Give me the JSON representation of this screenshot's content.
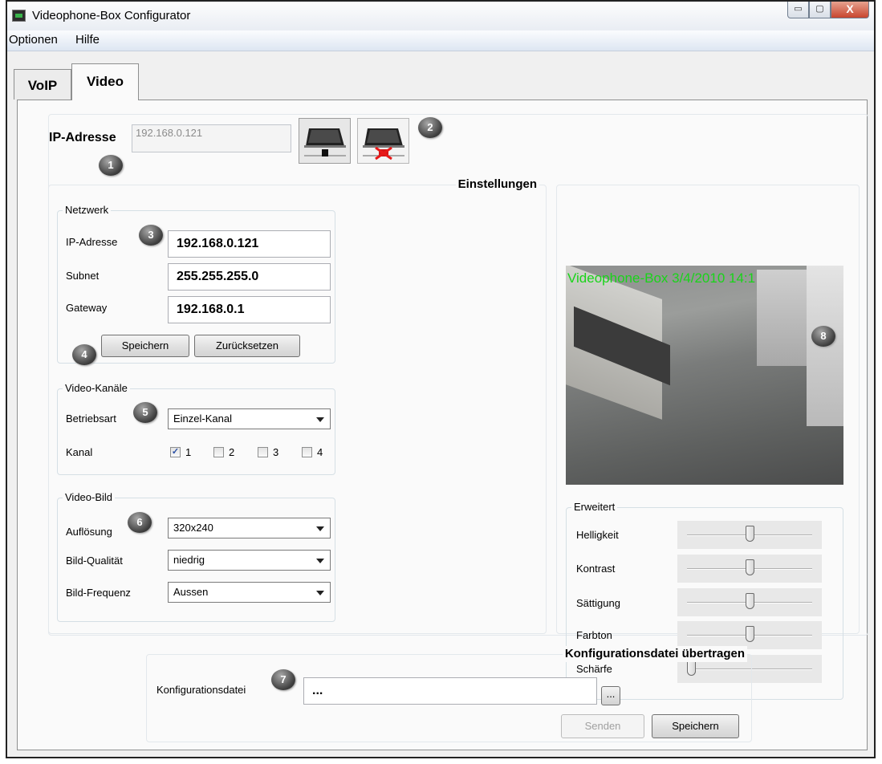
{
  "window": {
    "title": "Videophone-Box Configurator",
    "buttons": {
      "minimize": "▭",
      "maximize": "▢",
      "close": "X"
    }
  },
  "menu": [
    "Optionen",
    "Hilfe"
  ],
  "tabs": [
    {
      "label": "VoIP",
      "active": false
    },
    {
      "label": "Video",
      "active": true
    }
  ],
  "top": {
    "ip_label": "IP-Adresse",
    "ip_value": "192.168.0.121",
    "connect_icon": "monitor-connect-icon",
    "disconnect_icon": "monitor-disconnect-icon"
  },
  "badges": [
    "1",
    "2",
    "3",
    "4",
    "5",
    "6",
    "7",
    "8"
  ],
  "settings": {
    "title": "Einstellungen",
    "network": {
      "title": "Netzwerk",
      "ip_label": "IP-Adresse",
      "ip_value": "192.168.0.121",
      "subnet_label": "Subnet",
      "subnet_value": "255.255.255.0",
      "gateway_label": "Gateway",
      "gateway_value": "192.168.0.1",
      "save": "Speichern",
      "reset": "Zurücksetzen"
    },
    "channels": {
      "title": "Video-Kanäle",
      "mode_label": "Betriebsart",
      "mode_value": "Einzel-Kanal",
      "channel_label": "Kanal",
      "channels": [
        {
          "label": "1",
          "checked": true
        },
        {
          "label": "2",
          "checked": false
        },
        {
          "label": "3",
          "checked": false
        },
        {
          "label": "4",
          "checked": false
        }
      ]
    },
    "image": {
      "title": "Video-Bild",
      "resolution_label": "Auflösung",
      "resolution_value": "320x240",
      "quality_label": "Bild-Qualität",
      "quality_value": "niedrig",
      "frequency_label": "Bild-Frequenz",
      "frequency_value": "Aussen"
    }
  },
  "preview": {
    "overlay_text": "Videophone-Box 3/4/2010 14:1",
    "overlay_color": "#19d419",
    "advanced": {
      "title": "Erweitert",
      "sliders": [
        {
          "label": "Helligkeit",
          "value": 0.5
        },
        {
          "label": "Kontrast",
          "value": 0.5
        },
        {
          "label": "Sättigung",
          "value": 0.5
        },
        {
          "label": "Farbton",
          "value": 0.5
        },
        {
          "label": "Schärfe",
          "value": 0.0
        }
      ]
    }
  },
  "config": {
    "title": "Konfigurationsdatei übertragen",
    "file_label": "Konfigurationsdatei",
    "file_value": "...",
    "browse": "...",
    "send": "Senden",
    "save": "Speichern"
  }
}
